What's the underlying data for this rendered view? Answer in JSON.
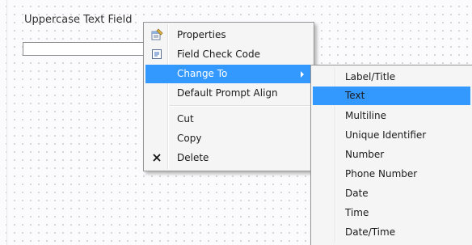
{
  "form": {
    "field_label": "Uppercase Text Field",
    "field_value": ""
  },
  "context_menu": {
    "items": [
      {
        "label": "Properties",
        "icon": "properties-icon"
      },
      {
        "label": "Field Check Code",
        "icon": "field-check-code-icon"
      },
      {
        "label": "Change To",
        "icon": "",
        "has_submenu": true,
        "highlighted": true
      },
      {
        "label": "Default Prompt Align",
        "icon": ""
      },
      {
        "label": "Cut",
        "icon": ""
      },
      {
        "label": "Copy",
        "icon": ""
      },
      {
        "label": "Delete",
        "icon": "delete-x-icon"
      }
    ]
  },
  "submenu": {
    "items": [
      {
        "label": "Label/Title"
      },
      {
        "label": "Text",
        "highlighted": true
      },
      {
        "label": "Multiline"
      },
      {
        "label": "Unique Identifier"
      },
      {
        "label": "Number"
      },
      {
        "label": "Phone Number"
      },
      {
        "label": "Date"
      },
      {
        "label": "Time"
      },
      {
        "label": "Date/Time"
      }
    ]
  },
  "colors": {
    "highlight": "#3399ff",
    "menu_background": "#f5f5f5",
    "menu_border": "#979797"
  }
}
